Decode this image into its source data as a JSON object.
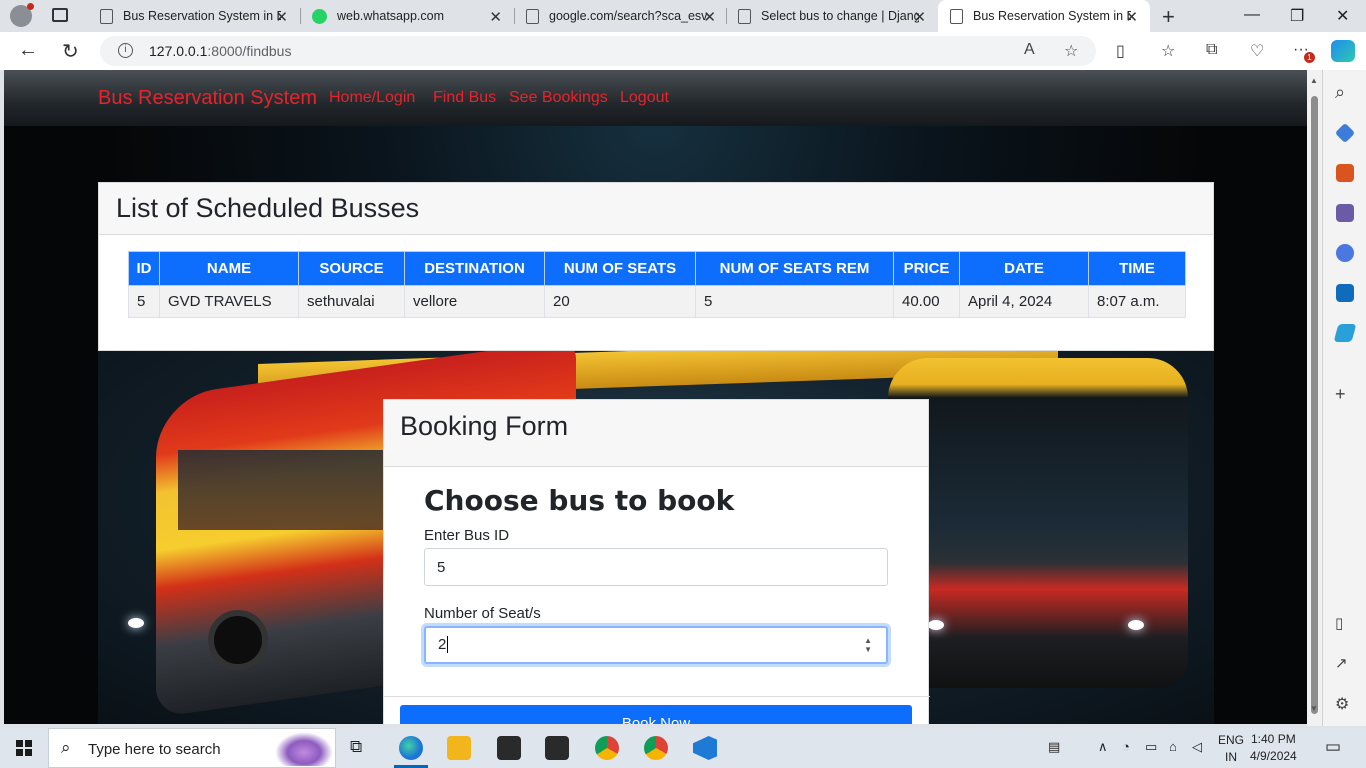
{
  "browser": {
    "tabs": [
      {
        "label": "Bus Reservation System in D",
        "close": "✕"
      },
      {
        "label": "web.whatsapp.com",
        "close": "✕"
      },
      {
        "label": "google.com/search?sca_esv",
        "close": "✕"
      },
      {
        "label": "Select bus to change | Djang",
        "close": "✕"
      },
      {
        "label": "Bus Reservation System in D",
        "close": "✕"
      }
    ],
    "url_host": "127.0.0.1",
    "url_path": ":8000/findbus",
    "notification_badge": "1"
  },
  "site": {
    "brand": "Bus Reservation System",
    "nav": [
      "Home/Login",
      "Find Bus",
      "See Bookings",
      "Logout"
    ],
    "brand_color": "#e8232b"
  },
  "bus_list": {
    "title": "List of Scheduled Busses",
    "columns": [
      "ID",
      "NAME",
      "SOURCE",
      "DESTINATION",
      "NUM OF SEATS",
      "NUM OF SEATS REM",
      "PRICE",
      "DATE",
      "TIME"
    ],
    "rows": [
      [
        "5",
        "GVD TRAVELS",
        "sethuvalai",
        "vellore",
        "20",
        "5",
        "40.00",
        "April 4, 2024",
        "8:07 a.m."
      ]
    ],
    "header_color": "#0d6efd"
  },
  "booking_form": {
    "header": "Booking Form",
    "title": "Choose bus to book",
    "bus_id_label": "Enter Bus ID",
    "bus_id_value": "5",
    "seats_label": "Number of Seat/s",
    "seats_value": "2",
    "submit": "Book Now"
  },
  "taskbar": {
    "search_placeholder": "Type here to search",
    "lang_top": "ENG",
    "lang_bottom": "IN",
    "time": "1:40 PM",
    "date": "4/9/2024"
  }
}
